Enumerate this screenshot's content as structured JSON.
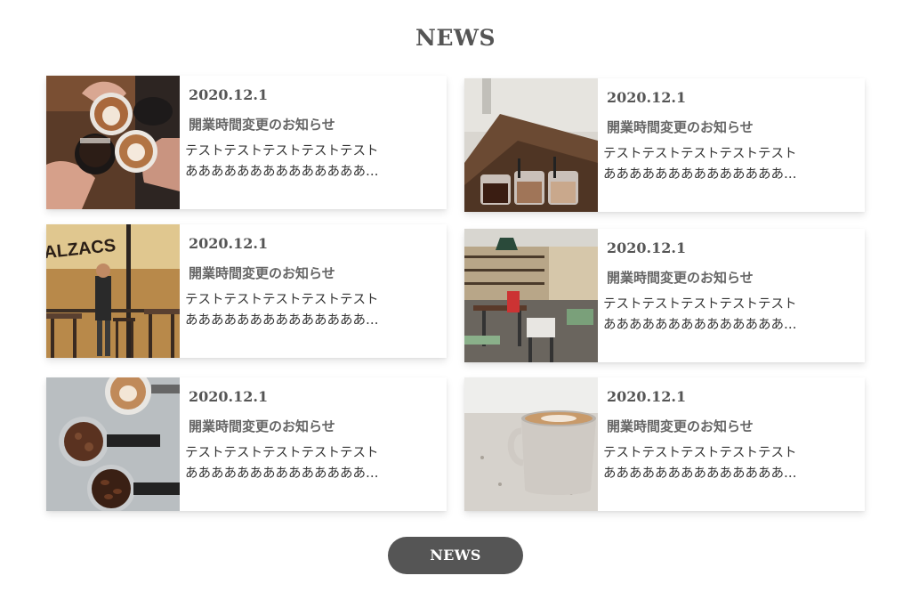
{
  "section": {
    "heading": "NEWS"
  },
  "news": [
    {
      "date": "2020.12.1",
      "title": "開業時間変更のお知らせ",
      "line1": "テストテストテストテストテスト",
      "line2": "ああああああああああああああ…",
      "image": "coffee-toast-photo"
    },
    {
      "date": "2020.12.1",
      "title": "開業時間変更のお知らせ",
      "line1": "テストテストテストテストテスト",
      "line2": "ああああああああああああああ…",
      "image": "coffee-cups-on-bar-photo"
    },
    {
      "date": "2020.12.1",
      "title": "開業時間変更のお知らせ",
      "line1": "テストテストテストテストテスト",
      "line2": "ああああああああああああああ…",
      "image": "cafe-storefront-photo",
      "sign": "ALZACS"
    },
    {
      "date": "2020.12.1",
      "title": "開業時間変更のお知らせ",
      "line1": "テストテストテストテストテスト",
      "line2": "ああああああああああああああ…",
      "image": "cafe-interior-photo"
    },
    {
      "date": "2020.12.1",
      "title": "開業時間変更のお知らせ",
      "line1": "テストテストテストテストテスト",
      "line2": "ああああああああああああああ…",
      "image": "espresso-grounds-beans-photo"
    },
    {
      "date": "2020.12.1",
      "title": "開業時間変更のお知らせ",
      "line1": "テストテストテストテストテスト",
      "line2": "ああああああああああああああ…",
      "image": "latte-mug-photo"
    }
  ],
  "more_button": {
    "label": "NEWS"
  },
  "colors": {
    "text": "#555555",
    "button_bg": "#555555",
    "button_text": "#ffffff"
  }
}
